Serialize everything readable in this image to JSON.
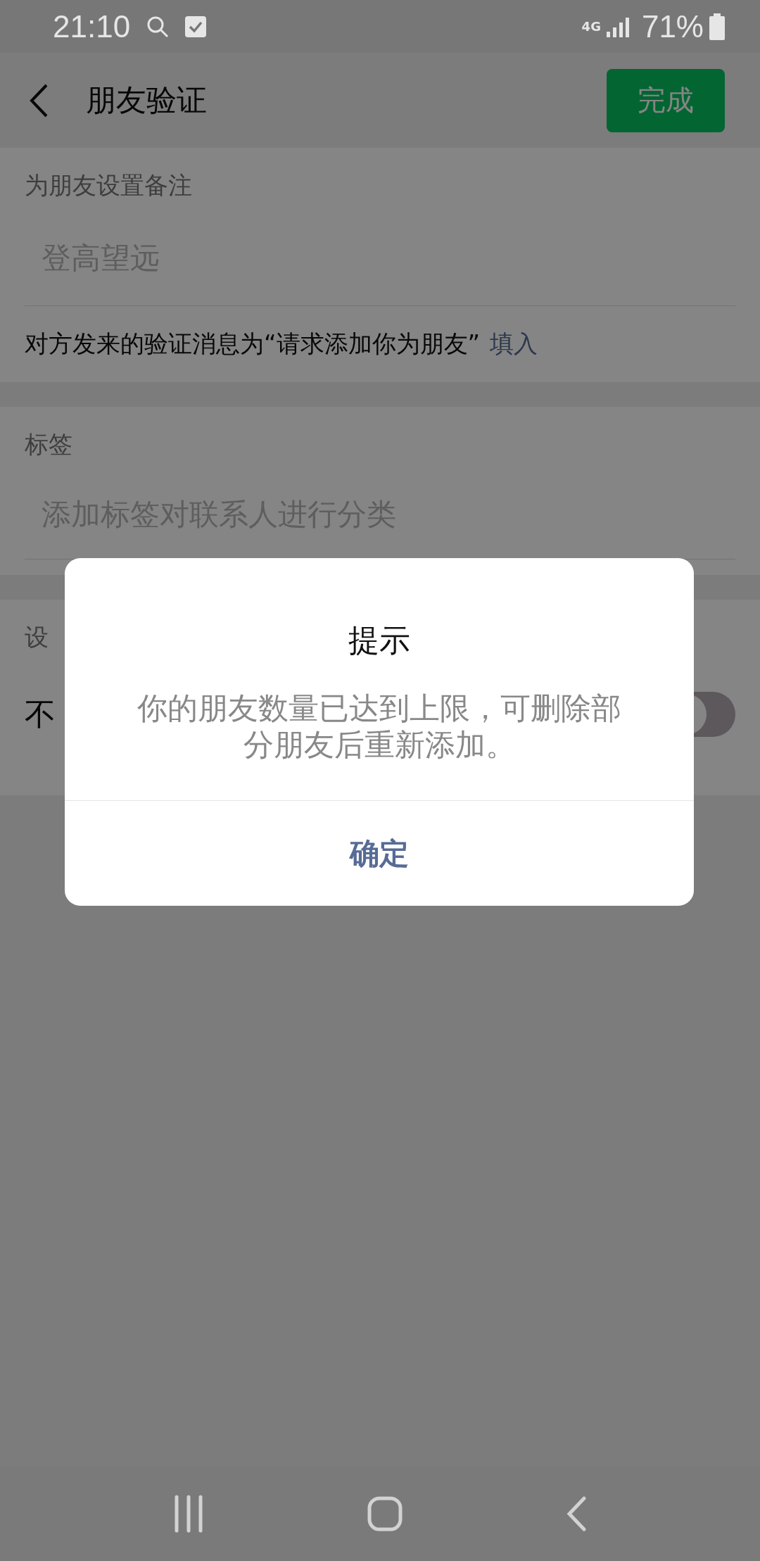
{
  "status_bar": {
    "time": "21:10",
    "network": "4G",
    "battery": "71%"
  },
  "header": {
    "title": "朋友验证",
    "done_button": "完成"
  },
  "remark_section": {
    "label": "为朋友设置备注",
    "field": {
      "placeholder": "登高望远"
    },
    "hint": "对方发来的验证消息为“请求添加你为朋友”",
    "fill_link": "填入"
  },
  "tag_section": {
    "label": "标签",
    "field": {
      "placeholder": "添加标签对联系人进行分类"
    }
  },
  "privacy_section": {
    "label": "设",
    "row": {
      "label": "不",
      "on": false
    }
  },
  "dialog": {
    "title": "提示",
    "message": "你的朋友数量已达到上限，可删除部分朋友后重新添加。",
    "button": "确定"
  }
}
